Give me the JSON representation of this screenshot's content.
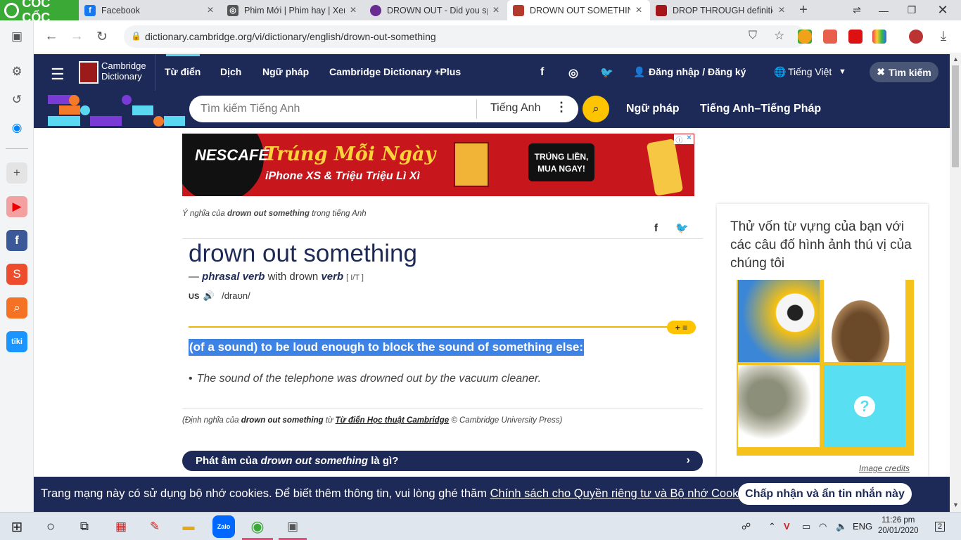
{
  "browser": {
    "brand": "CỐC CỐC",
    "tabs": [
      {
        "title": "Facebook",
        "favicon_color": "#1877f2",
        "active": false
      },
      {
        "title": "Phim Mới | Phim hay | Xem",
        "favicon_color": "#555555",
        "active": false
      },
      {
        "title": "DROWN OUT - Did you spe",
        "favicon_color": "#6b2c91",
        "active": false
      },
      {
        "title": "DROWN OUT SOMETHING",
        "favicon_color": "#b33b2b",
        "active": true
      },
      {
        "title": "DROP THROUGH definition",
        "favicon_color": "#a4161a",
        "active": false
      }
    ],
    "url": "dictionary.cambridge.org/vi/dictionary/english/drown-out-something"
  },
  "header": {
    "logo_line1": "Cambridge",
    "logo_line2": "Dictionary",
    "nav": [
      "Từ điển",
      "Dịch",
      "Ngữ pháp",
      "Cambridge Dictionary +Plus"
    ],
    "login": "Đăng nhập / Đăng ký",
    "language": "Tiếng Việt",
    "search_button": "Tìm kiếm",
    "search_placeholder": "Tìm kiếm Tiếng Anh",
    "search_lang": "Tiếng Anh",
    "subnav": [
      "Ngữ pháp",
      "Tiếng Anh–Tiếng Pháp"
    ]
  },
  "ad": {
    "brand": "NESCAFÉ",
    "headline": "Trúng Mỗi Ngày",
    "subline": "iPhone XS & Triệu Triệu Lì Xì",
    "cta_line1": "TRÚNG LIỀN,",
    "cta_line2": "MUA NGAY!"
  },
  "entry": {
    "crumb_prefix": "Ý nghĩa của",
    "crumb_word": "drown out something",
    "crumb_suffix": "trong tiếng Anh",
    "headword": "drown out something",
    "pos_dash": "—",
    "pos": "phrasal verb",
    "pos_with": "with drown",
    "pos_verb": "verb",
    "grammar": "[ I/T ]",
    "region": "US",
    "ipa": "/draʊn/",
    "add_list": "+ ≡",
    "definition": "(of a sound) to be loud enough to block the sound of something else:",
    "example": "The sound of the telephone was drowned out by the vacuum cleaner.",
    "source_prefix": "(Định nghĩa của",
    "source_word": "drown out something",
    "source_from": "từ",
    "source_link": "Từ điển Học thuật Cambridge",
    "source_suffix": "© Cambridge University Press)",
    "pron_bar_prefix": "Phát âm của",
    "pron_bar_word": "drown out something",
    "pron_bar_suffix": "là gì?"
  },
  "quiz": {
    "title": "Thử vốn từ vựng của bạn với các câu đố hình ảnh thú vị của chúng tôi",
    "credits": "Image credits"
  },
  "cookie": {
    "text": "Trang mạng này có sử dụng bộ nhớ cookies. Để biết thêm thông tin, vui lòng ghé thăm",
    "link": "Chính sách cho Quyền riêng tư và Bộ nhớ Cookies",
    "button": "Chấp nhận và ẩn tin nhắn này"
  },
  "taskbar": {
    "lang": "ENG",
    "time": "11:26 pm",
    "date": "20/01/2020",
    "notif_count": "2"
  }
}
